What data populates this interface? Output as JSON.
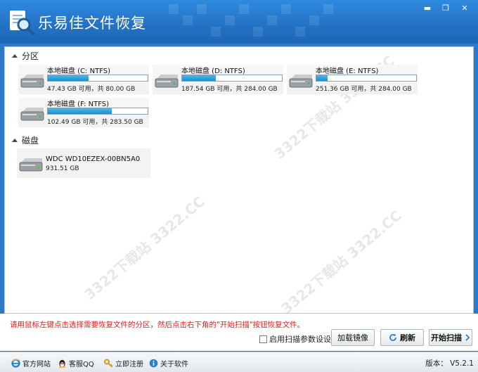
{
  "window": {
    "title": "乐易佳文件恢复",
    "minimize": "▬",
    "maximize": "❐",
    "close": "✕"
  },
  "sections": {
    "partitions_label": "分区",
    "disks_label": "磁盘"
  },
  "partitions": [
    {
      "name": "本地磁盘 (C: NTFS)",
      "size": "47.43 GB 可用，共 80.00 GB",
      "used_fraction": 0.41
    },
    {
      "name": "本地磁盘 (D: NTFS)",
      "size": "187.54 GB 可用，共 284.00 GB",
      "used_fraction": 0.34
    },
    {
      "name": "本地磁盘 (E: NTFS)",
      "size": "251.36 GB 可用，共 284.00 GB",
      "used_fraction": 0.11
    },
    {
      "name": "本地磁盘 (F: NTFS)",
      "size": "102.49 GB 可用，共 283.50 GB",
      "used_fraction": 0.64
    }
  ],
  "disks": [
    {
      "name": "WDC WD10EZEX-00BN5A0",
      "size": "931.51 GB"
    }
  ],
  "watermark": "3322下载站 3322.CC",
  "hint": "请用鼠标左键点击选择需要恢复文件的分区，然后点击右下角的\"开始扫描\"按钮恢复文件。",
  "options": {
    "scan_params": "启用扫描参数设设"
  },
  "buttons": {
    "load_image": "加载镜像",
    "refresh": "刷新",
    "start_scan": "开始扫描"
  },
  "footer": {
    "website": "官方网站",
    "qq": "客服QQ",
    "register": "立即注册",
    "about": "关于软件",
    "version": "版本： V5.2.1"
  },
  "colors": {
    "titlebar": "#2473c6",
    "progress": "#1b8fc7",
    "hint": "#e02020"
  }
}
